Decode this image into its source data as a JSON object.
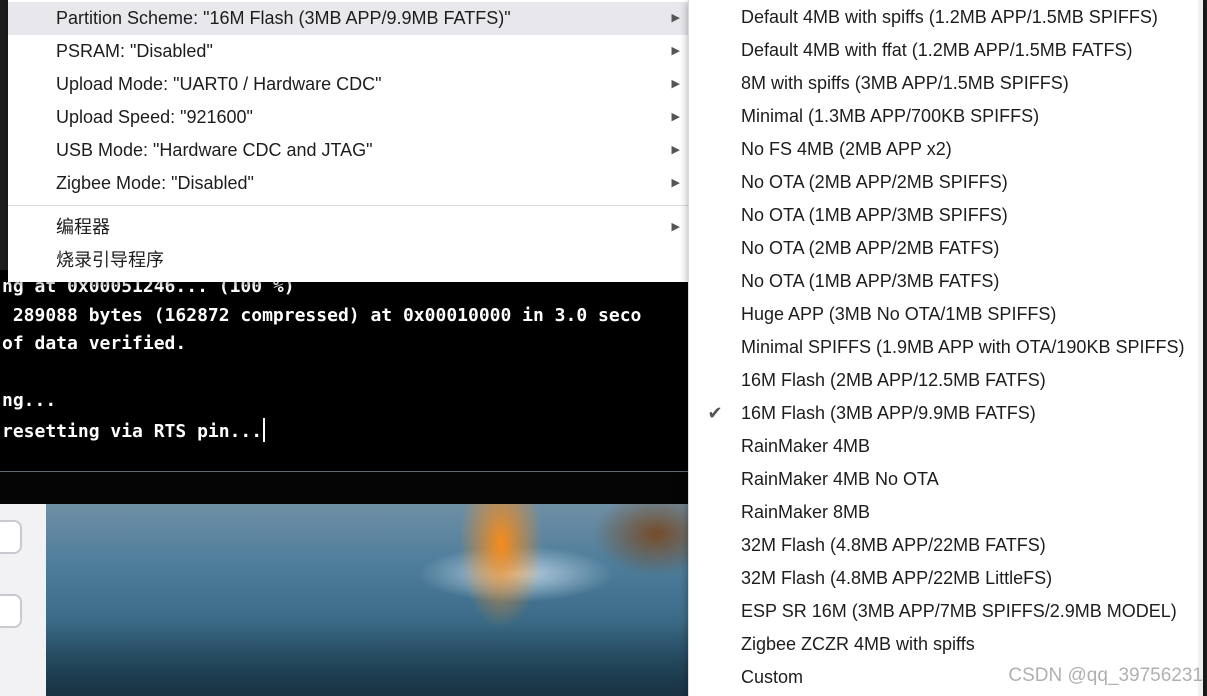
{
  "main_menu": {
    "items": [
      {
        "label": "Partition Scheme: \"16M Flash (3MB APP/9.9MB FATFS)\"",
        "has_submenu": true,
        "highlighted": true
      },
      {
        "label": "PSRAM: \"Disabled\"",
        "has_submenu": true
      },
      {
        "label": "Upload Mode: \"UART0 / Hardware CDC\"",
        "has_submenu": true
      },
      {
        "label": "Upload Speed: \"921600\"",
        "has_submenu": true
      },
      {
        "label": "USB Mode: \"Hardware CDC and JTAG\"",
        "has_submenu": true
      },
      {
        "label": "Zigbee Mode: \"Disabled\"",
        "has_submenu": true
      },
      {
        "label": "编程器",
        "has_submenu": true
      },
      {
        "label": "烧录引导程序",
        "has_submenu": false
      }
    ],
    "arrow_glyph": "▶"
  },
  "submenu": {
    "check_glyph": "✔",
    "items": [
      {
        "label": "Default 4MB with spiffs (1.2MB APP/1.5MB SPIFFS)",
        "checked": false
      },
      {
        "label": "Default 4MB with ffat (1.2MB APP/1.5MB FATFS)",
        "checked": false
      },
      {
        "label": "8M with spiffs (3MB APP/1.5MB SPIFFS)",
        "checked": false
      },
      {
        "label": "Minimal (1.3MB APP/700KB SPIFFS)",
        "checked": false
      },
      {
        "label": "No FS 4MB (2MB APP x2)",
        "checked": false
      },
      {
        "label": "No OTA (2MB APP/2MB SPIFFS)",
        "checked": false
      },
      {
        "label": "No OTA (1MB APP/3MB SPIFFS)",
        "checked": false
      },
      {
        "label": "No OTA (2MB APP/2MB FATFS)",
        "checked": false
      },
      {
        "label": "No OTA (1MB APP/3MB FATFS)",
        "checked": false
      },
      {
        "label": "Huge APP (3MB No OTA/1MB SPIFFS)",
        "checked": false
      },
      {
        "label": "Minimal SPIFFS (1.9MB APP with OTA/190KB SPIFFS)",
        "checked": false
      },
      {
        "label": "16M Flash (2MB APP/12.5MB FATFS)",
        "checked": false
      },
      {
        "label": "16M Flash (3MB APP/9.9MB FATFS)",
        "checked": true
      },
      {
        "label": "RainMaker 4MB",
        "checked": false
      },
      {
        "label": "RainMaker 4MB No OTA",
        "checked": false
      },
      {
        "label": "RainMaker 8MB",
        "checked": false
      },
      {
        "label": "32M Flash (4.8MB APP/22MB FATFS)",
        "checked": false
      },
      {
        "label": "32M Flash (4.8MB APP/22MB LittleFS)",
        "checked": false
      },
      {
        "label": "ESP SR 16M (3MB APP/7MB SPIFFS/2.9MB MODEL)",
        "checked": false
      },
      {
        "label": "Zigbee ZCZR 4MB with spiffs",
        "checked": false
      },
      {
        "label": "Custom",
        "checked": false
      }
    ]
  },
  "console": {
    "lines": [
      "ng at 0x00051246... (100 %)",
      " 289088 bytes (162872 compressed) at 0x00010000 in 3.0 seco",
      "of data verified.",
      "",
      "ng...",
      "resetting via RTS pin..."
    ]
  },
  "left_rail": {
    "icons": [
      "board-icon",
      "library-icon"
    ]
  },
  "watermark": "CSDN @qq_39756231",
  "colors": {
    "menu_bg": "#ffffff",
    "menu_highlight": "#e8e8ec",
    "console_bg": "#000000",
    "console_text": "#ffffff"
  }
}
